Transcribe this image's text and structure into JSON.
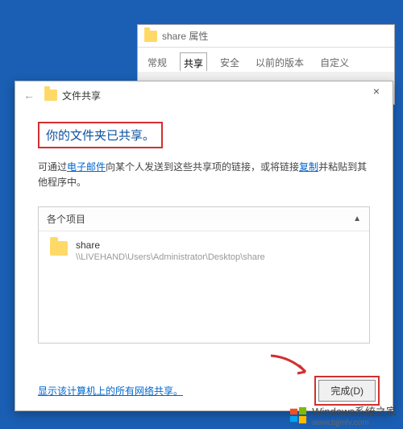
{
  "propWindow": {
    "title": "share 属性",
    "tabs": [
      "常规",
      "共享",
      "安全",
      "以前的版本",
      "自定义"
    ],
    "activeTab": 1
  },
  "shareDialog": {
    "title": "文件共享",
    "closeLabel": "×",
    "backArrow": "←",
    "heading": "你的文件夹已共享。",
    "descPrefix": "可通过",
    "descLink1": "电子邮件",
    "descMiddle": "向某个人发送到这些共享项的链接，或将链接",
    "descLink2": "复制",
    "descSuffix": "并粘贴到其他程序中。",
    "itemsHeader": "各个项目",
    "item": {
      "name": "share",
      "path": "\\\\LIVEHAND\\Users\\Administrator\\Desktop\\share"
    },
    "bottomLink": "显示该计算机上的所有网络共享。",
    "doneButton": "完成(D)"
  },
  "watermark": {
    "title": "Windows系统之家",
    "url": "www.bjjmlv.com"
  }
}
